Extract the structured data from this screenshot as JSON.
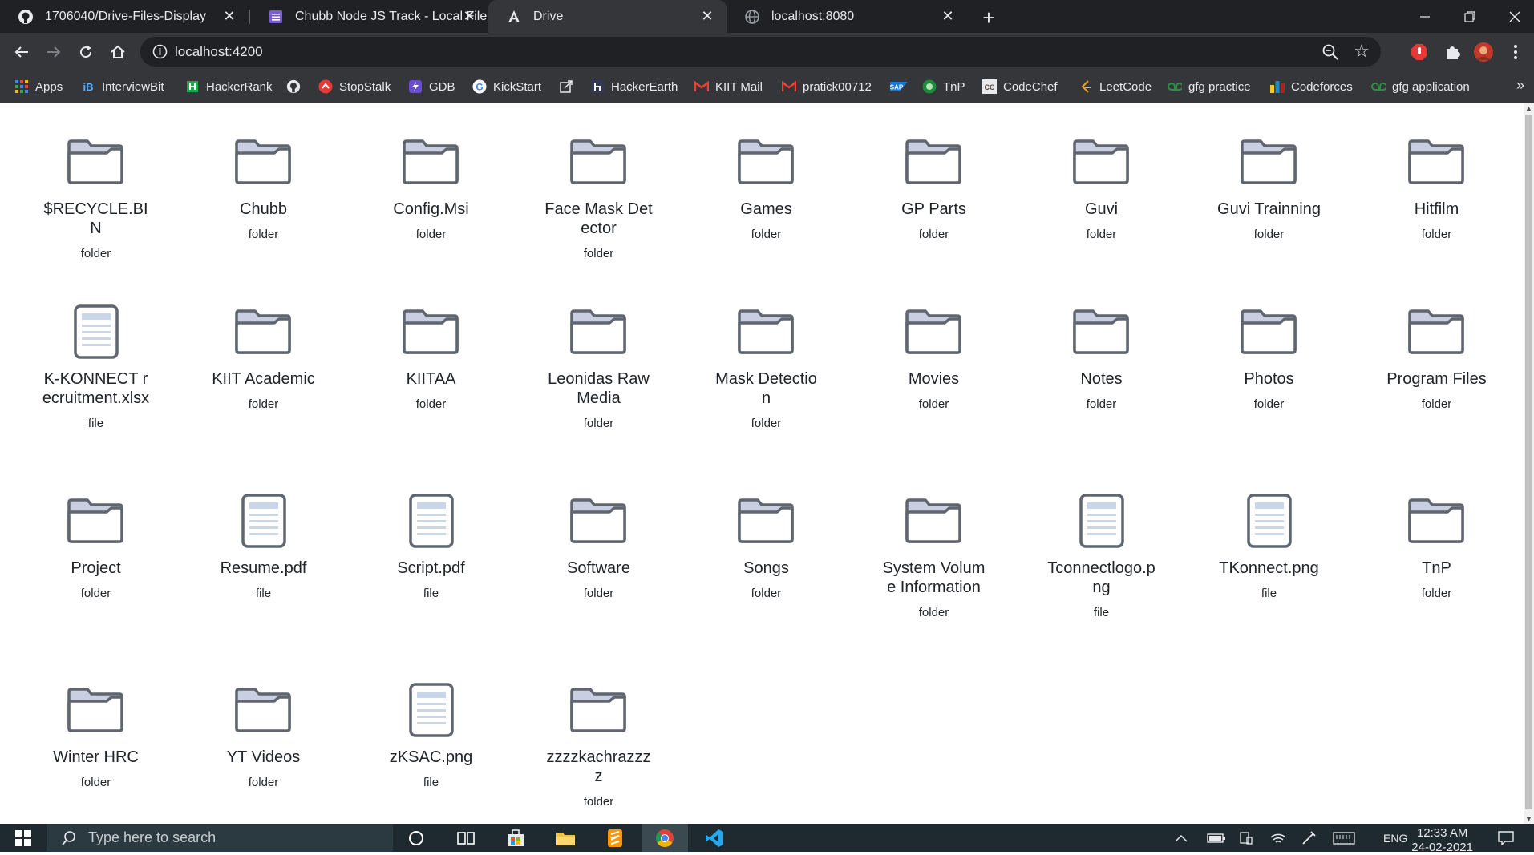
{
  "browser": {
    "tabs": [
      {
        "title": "1706040/Drive-Files-Display",
        "favicon": "github-icon",
        "active": false
      },
      {
        "title": "Chubb Node JS Track - Local File",
        "favicon": "doc-list-icon",
        "active": false
      },
      {
        "title": "Drive",
        "favicon": "angular-icon",
        "active": true
      },
      {
        "title": "localhost:8080",
        "favicon": "globe-icon",
        "active": false
      }
    ],
    "close_glyph": "✕",
    "new_tab_glyph": "+",
    "address": "localhost:4200",
    "bookmarks": [
      {
        "label": "Apps",
        "icon": "apps-grid-icon"
      },
      {
        "label": "InterviewBit",
        "icon": "interviewbit-icon"
      },
      {
        "label": "HackerRank",
        "icon": "hackerrank-icon"
      },
      {
        "label": "",
        "icon": "github-icon"
      },
      {
        "label": "StopStalk",
        "icon": "stopstalk-icon"
      },
      {
        "label": "GDB",
        "icon": "gdb-icon"
      },
      {
        "label": "KickStart",
        "icon": "google-icon"
      },
      {
        "label": "",
        "icon": "external-link-icon"
      },
      {
        "label": "HackerEarth",
        "icon": "hackerearth-icon"
      },
      {
        "label": "KIIT Mail",
        "icon": "gmail-icon"
      },
      {
        "label": "pratick00712",
        "icon": "gmail-icon"
      },
      {
        "label": "",
        "icon": "sap-icon"
      },
      {
        "label": "TnP",
        "icon": "tnp-icon"
      },
      {
        "label": "CodeChef",
        "icon": "codechef-icon"
      },
      {
        "label": "LeetCode",
        "icon": "leetcode-icon"
      },
      {
        "label": "gfg practice",
        "icon": "gfg-icon"
      },
      {
        "label": "Codeforces",
        "icon": "codeforces-icon"
      },
      {
        "label": "gfg application",
        "icon": "gfg-icon"
      }
    ],
    "bookmarks_more": "»"
  },
  "drive": {
    "items": [
      {
        "name": "$RECYCLE.BIN",
        "type": "folder"
      },
      {
        "name": "Chubb",
        "type": "folder"
      },
      {
        "name": "Config.Msi",
        "type": "folder"
      },
      {
        "name": "Face Mask Detector",
        "type": "folder"
      },
      {
        "name": "Games",
        "type": "folder"
      },
      {
        "name": "GP Parts",
        "type": "folder"
      },
      {
        "name": "Guvi",
        "type": "folder"
      },
      {
        "name": "Guvi Trainning",
        "type": "folder"
      },
      {
        "name": "Hitfilm",
        "type": "folder"
      },
      {
        "name": "K-KONNECT recruitment.xlsx",
        "type": "file"
      },
      {
        "name": "KIIT Academic",
        "type": "folder"
      },
      {
        "name": "KIITAA",
        "type": "folder"
      },
      {
        "name": "Leonidas Raw Media",
        "type": "folder"
      },
      {
        "name": "Mask Detection",
        "type": "folder"
      },
      {
        "name": "Movies",
        "type": "folder"
      },
      {
        "name": "Notes",
        "type": "folder"
      },
      {
        "name": "Photos",
        "type": "folder"
      },
      {
        "name": "Program Files",
        "type": "folder"
      },
      {
        "name": "Project",
        "type": "folder"
      },
      {
        "name": "Resume.pdf",
        "type": "file"
      },
      {
        "name": "Script.pdf",
        "type": "file"
      },
      {
        "name": "Software",
        "type": "folder"
      },
      {
        "name": "Songs",
        "type": "folder"
      },
      {
        "name": "System Volume Information",
        "type": "folder"
      },
      {
        "name": "Tconnectlogo.png",
        "type": "file"
      },
      {
        "name": "TKonnect.png",
        "type": "file"
      },
      {
        "name": "TnP",
        "type": "folder"
      },
      {
        "name": "Winter HRC",
        "type": "folder"
      },
      {
        "name": "YT Videos",
        "type": "folder"
      },
      {
        "name": "zKSAC.png",
        "type": "file"
      },
      {
        "name": "zzzzkachrazzzz",
        "type": "folder"
      }
    ]
  },
  "taskbar": {
    "search_placeholder": "Type here to search",
    "tray_lang": "ENG",
    "time": "12:33 AM",
    "date": "24-02-2021"
  },
  "colors": {
    "folder_stroke": "#5f6670",
    "folder_fill": "#c9cfe0",
    "file_lines": "#c9d6ea",
    "text": "#212529"
  }
}
